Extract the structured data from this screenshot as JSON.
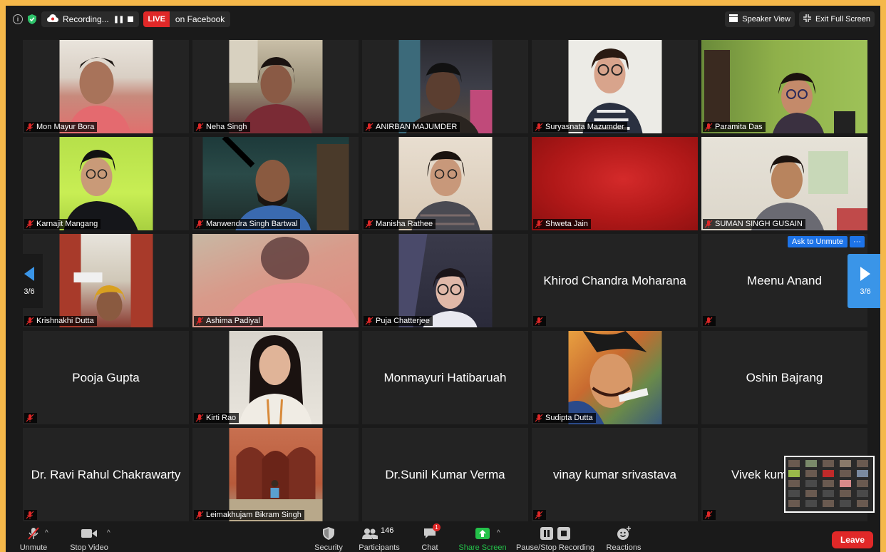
{
  "topbar": {
    "recording_label": "Recording...",
    "live_badge": "LIVE",
    "live_destination": "on Facebook",
    "speaker_view_label": "Speaker View",
    "exit_fullscreen_label": "Exit Full Screen"
  },
  "gallery": {
    "page_indicator": "3/6",
    "ask_to_unmute_label": "Ask to Unmute",
    "more_label": "···",
    "participants": [
      {
        "name": "Mon Mayur Bora",
        "video": true
      },
      {
        "name": "Neha Singh",
        "video": true
      },
      {
        "name": "ANIRBAN MAJUMDER",
        "video": true
      },
      {
        "name": "Suryasnata Mazumder",
        "video": true
      },
      {
        "name": "Paramita Das",
        "video": true
      },
      {
        "name": "Karnajit Mangang",
        "video": true
      },
      {
        "name": "Manwendra Singh Bartwal",
        "video": true
      },
      {
        "name": "Manisha Rathee",
        "video": true
      },
      {
        "name": "Shweta Jain",
        "video": true
      },
      {
        "name": "SUMAN SINGH GUSAIN",
        "video": true
      },
      {
        "name": "Krishnakhi Dutta",
        "video": true
      },
      {
        "name": "Ashima Padiyal",
        "video": true
      },
      {
        "name": "Puja Chatterjee",
        "video": true
      },
      {
        "name": "Khirod Chandra Moharana",
        "video": false
      },
      {
        "name": "Meenu Anand",
        "video": false
      },
      {
        "name": "Pooja Gupta",
        "video": false
      },
      {
        "name": "Kirti Rao",
        "video": true
      },
      {
        "name": "Monmayuri Hatibaruah",
        "video": false
      },
      {
        "name": "Sudipta Dutta",
        "video": true
      },
      {
        "name": "Oshin Bajrang",
        "video": false
      },
      {
        "name": "Dr. Ravi Rahul Chakrawarty",
        "video": false
      },
      {
        "name": "Leimakhujam Bikram Singh",
        "video": true
      },
      {
        "name": "Dr.Sunil Kumar Verma",
        "video": false
      },
      {
        "name": "vinay kumar srivastava",
        "video": false
      },
      {
        "name": "Vivek kum",
        "video": false
      }
    ]
  },
  "toolbar": {
    "unmute_label": "Unmute",
    "stop_video_label": "Stop Video",
    "security_label": "Security",
    "participants_label": "Participants",
    "participants_count": "146",
    "chat_label": "Chat",
    "chat_unread": "1",
    "share_screen_label": "Share Screen",
    "recording_label": "Pause/Stop Recording",
    "reactions_label": "Reactions",
    "leave_label": "Leave"
  },
  "colors": {
    "frame": "#f5b84a",
    "background": "#1a1a1a",
    "tile": "#232323",
    "live_red": "#e02828",
    "accent_blue": "#1d73e8",
    "share_green": "#24c24a"
  }
}
